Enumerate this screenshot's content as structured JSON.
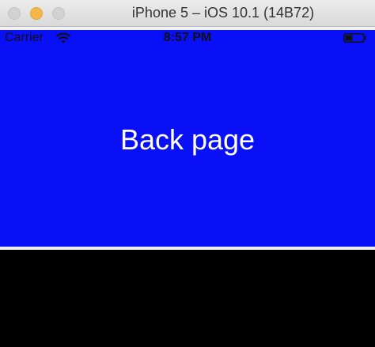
{
  "window": {
    "title": "iPhone 5 – iOS 10.1 (14B72)"
  },
  "status_bar": {
    "carrier": "Carrier",
    "time": "8:57 PM",
    "icons": [
      "wifi-icon",
      "battery-icon"
    ]
  },
  "page": {
    "heading": "Back page",
    "background_color": "#0a10f5",
    "text_color": "#ffffff"
  }
}
